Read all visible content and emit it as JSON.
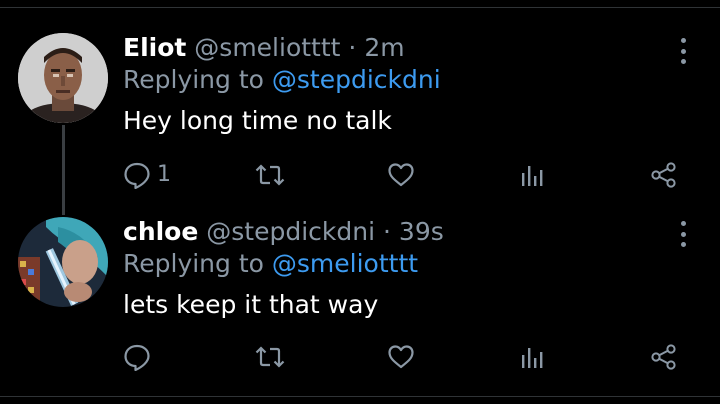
{
  "tweets": [
    {
      "name": "Eliot",
      "handle": "@smeliotttt",
      "separator": "·",
      "time": "2m",
      "replying_prefix": "Replying to ",
      "replying_to": "@stepdickdni",
      "text": "Hey long time no talk",
      "reply_count": "1",
      "icons": [
        "reply-icon",
        "retweet-icon",
        "like-icon",
        "analytics-icon",
        "share-icon",
        "more-icon"
      ]
    },
    {
      "name": "chloe",
      "handle": "@stepdickdni",
      "separator": "·",
      "time": "39s",
      "replying_prefix": "Replying to ",
      "replying_to": "@smeliotttt",
      "text": "lets keep it that way",
      "reply_count": "",
      "icons": [
        "reply-icon",
        "retweet-icon",
        "like-icon",
        "analytics-icon",
        "share-icon",
        "more-icon"
      ]
    }
  ],
  "colors": {
    "background": "#000000",
    "secondary_text": "#8b98a5",
    "link": "#3d9bf0",
    "divider": "#2f3336"
  }
}
